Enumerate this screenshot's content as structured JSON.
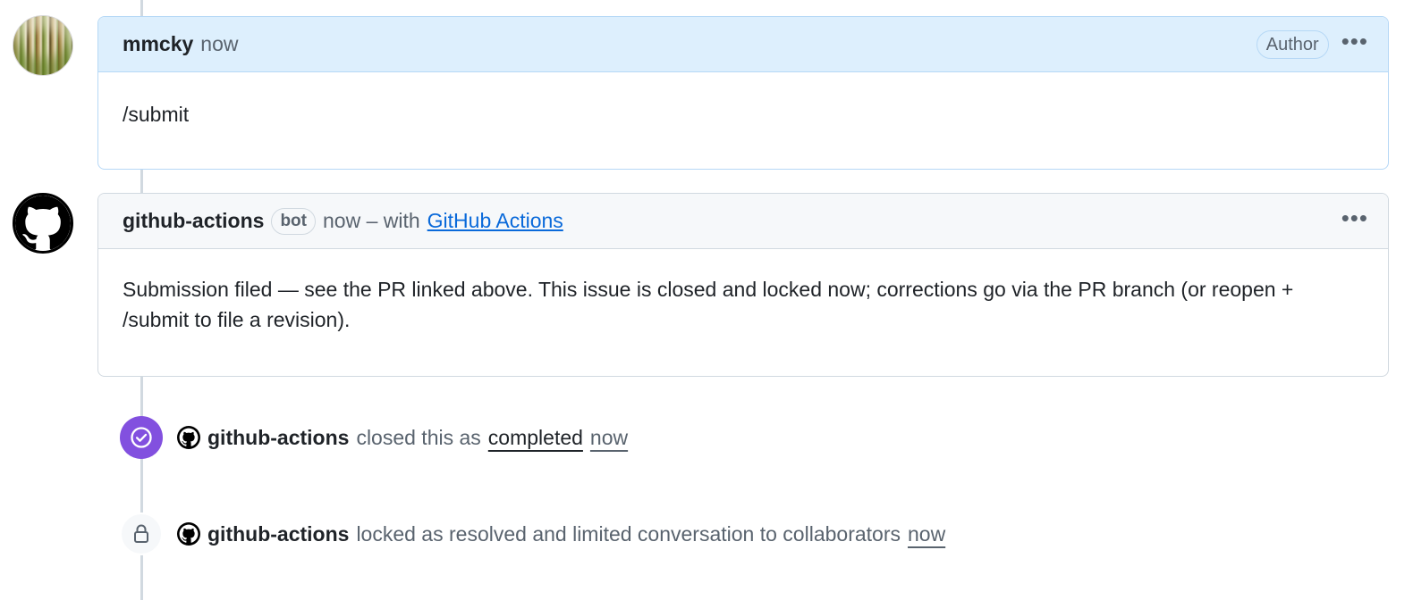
{
  "comment_1": {
    "author": "mmcky",
    "time": "now",
    "role_badge": "Author",
    "menu_label": "•••",
    "body": "/submit"
  },
  "comment_2": {
    "author": "github-actions",
    "bot_badge": "bot",
    "time_prefix": "now – with",
    "app_link": "GitHub Actions",
    "menu_label": "•••",
    "body": "Submission filed — see the PR linked above. This issue is closed and locked now; corrections go via the PR branch (or reopen + /submit to file a revision)."
  },
  "event_closed": {
    "actor": "github-actions",
    "text": "closed this as",
    "state_link": "completed",
    "time": "now"
  },
  "event_locked": {
    "actor": "github-actions",
    "text": "locked as resolved and limited conversation to collaborators",
    "time": "now"
  },
  "colors": {
    "closed_badge": "#8250df",
    "link": "#0969da",
    "author_header_bg": "#ddeffd"
  },
  "icons": {
    "closed": "check-circle-icon",
    "locked": "lock-icon",
    "avatar_bot": "github-mark-icon"
  }
}
